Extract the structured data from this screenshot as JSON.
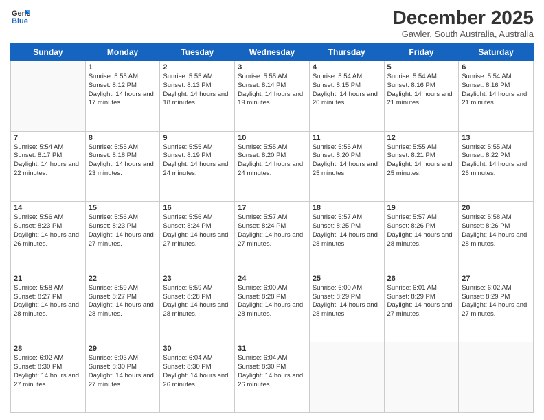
{
  "header": {
    "logo_line1": "General",
    "logo_line2": "Blue",
    "month": "December 2025",
    "location": "Gawler, South Australia, Australia"
  },
  "days_of_week": [
    "Sunday",
    "Monday",
    "Tuesday",
    "Wednesday",
    "Thursday",
    "Friday",
    "Saturday"
  ],
  "weeks": [
    [
      {
        "day": "",
        "sunrise": "",
        "sunset": "",
        "daylight": ""
      },
      {
        "day": "1",
        "sunrise": "Sunrise: 5:55 AM",
        "sunset": "Sunset: 8:12 PM",
        "daylight": "Daylight: 14 hours and 17 minutes."
      },
      {
        "day": "2",
        "sunrise": "Sunrise: 5:55 AM",
        "sunset": "Sunset: 8:13 PM",
        "daylight": "Daylight: 14 hours and 18 minutes."
      },
      {
        "day": "3",
        "sunrise": "Sunrise: 5:55 AM",
        "sunset": "Sunset: 8:14 PM",
        "daylight": "Daylight: 14 hours and 19 minutes."
      },
      {
        "day": "4",
        "sunrise": "Sunrise: 5:54 AM",
        "sunset": "Sunset: 8:15 PM",
        "daylight": "Daylight: 14 hours and 20 minutes."
      },
      {
        "day": "5",
        "sunrise": "Sunrise: 5:54 AM",
        "sunset": "Sunset: 8:16 PM",
        "daylight": "Daylight: 14 hours and 21 minutes."
      },
      {
        "day": "6",
        "sunrise": "Sunrise: 5:54 AM",
        "sunset": "Sunset: 8:16 PM",
        "daylight": "Daylight: 14 hours and 21 minutes."
      }
    ],
    [
      {
        "day": "7",
        "sunrise": "Sunrise: 5:54 AM",
        "sunset": "Sunset: 8:17 PM",
        "daylight": "Daylight: 14 hours and 22 minutes."
      },
      {
        "day": "8",
        "sunrise": "Sunrise: 5:55 AM",
        "sunset": "Sunset: 8:18 PM",
        "daylight": "Daylight: 14 hours and 23 minutes."
      },
      {
        "day": "9",
        "sunrise": "Sunrise: 5:55 AM",
        "sunset": "Sunset: 8:19 PM",
        "daylight": "Daylight: 14 hours and 24 minutes."
      },
      {
        "day": "10",
        "sunrise": "Sunrise: 5:55 AM",
        "sunset": "Sunset: 8:20 PM",
        "daylight": "Daylight: 14 hours and 24 minutes."
      },
      {
        "day": "11",
        "sunrise": "Sunrise: 5:55 AM",
        "sunset": "Sunset: 8:20 PM",
        "daylight": "Daylight: 14 hours and 25 minutes."
      },
      {
        "day": "12",
        "sunrise": "Sunrise: 5:55 AM",
        "sunset": "Sunset: 8:21 PM",
        "daylight": "Daylight: 14 hours and 25 minutes."
      },
      {
        "day": "13",
        "sunrise": "Sunrise: 5:55 AM",
        "sunset": "Sunset: 8:22 PM",
        "daylight": "Daylight: 14 hours and 26 minutes."
      }
    ],
    [
      {
        "day": "14",
        "sunrise": "Sunrise: 5:56 AM",
        "sunset": "Sunset: 8:23 PM",
        "daylight": "Daylight: 14 hours and 26 minutes."
      },
      {
        "day": "15",
        "sunrise": "Sunrise: 5:56 AM",
        "sunset": "Sunset: 8:23 PM",
        "daylight": "Daylight: 14 hours and 27 minutes."
      },
      {
        "day": "16",
        "sunrise": "Sunrise: 5:56 AM",
        "sunset": "Sunset: 8:24 PM",
        "daylight": "Daylight: 14 hours and 27 minutes."
      },
      {
        "day": "17",
        "sunrise": "Sunrise: 5:57 AM",
        "sunset": "Sunset: 8:24 PM",
        "daylight": "Daylight: 14 hours and 27 minutes."
      },
      {
        "day": "18",
        "sunrise": "Sunrise: 5:57 AM",
        "sunset": "Sunset: 8:25 PM",
        "daylight": "Daylight: 14 hours and 28 minutes."
      },
      {
        "day": "19",
        "sunrise": "Sunrise: 5:57 AM",
        "sunset": "Sunset: 8:26 PM",
        "daylight": "Daylight: 14 hours and 28 minutes."
      },
      {
        "day": "20",
        "sunrise": "Sunrise: 5:58 AM",
        "sunset": "Sunset: 8:26 PM",
        "daylight": "Daylight: 14 hours and 28 minutes."
      }
    ],
    [
      {
        "day": "21",
        "sunrise": "Sunrise: 5:58 AM",
        "sunset": "Sunset: 8:27 PM",
        "daylight": "Daylight: 14 hours and 28 minutes."
      },
      {
        "day": "22",
        "sunrise": "Sunrise: 5:59 AM",
        "sunset": "Sunset: 8:27 PM",
        "daylight": "Daylight: 14 hours and 28 minutes."
      },
      {
        "day": "23",
        "sunrise": "Sunrise: 5:59 AM",
        "sunset": "Sunset: 8:28 PM",
        "daylight": "Daylight: 14 hours and 28 minutes."
      },
      {
        "day": "24",
        "sunrise": "Sunrise: 6:00 AM",
        "sunset": "Sunset: 8:28 PM",
        "daylight": "Daylight: 14 hours and 28 minutes."
      },
      {
        "day": "25",
        "sunrise": "Sunrise: 6:00 AM",
        "sunset": "Sunset: 8:29 PM",
        "daylight": "Daylight: 14 hours and 28 minutes."
      },
      {
        "day": "26",
        "sunrise": "Sunrise: 6:01 AM",
        "sunset": "Sunset: 8:29 PM",
        "daylight": "Daylight: 14 hours and 27 minutes."
      },
      {
        "day": "27",
        "sunrise": "Sunrise: 6:02 AM",
        "sunset": "Sunset: 8:29 PM",
        "daylight": "Daylight: 14 hours and 27 minutes."
      }
    ],
    [
      {
        "day": "28",
        "sunrise": "Sunrise: 6:02 AM",
        "sunset": "Sunset: 8:30 PM",
        "daylight": "Daylight: 14 hours and 27 minutes."
      },
      {
        "day": "29",
        "sunrise": "Sunrise: 6:03 AM",
        "sunset": "Sunset: 8:30 PM",
        "daylight": "Daylight: 14 hours and 27 minutes."
      },
      {
        "day": "30",
        "sunrise": "Sunrise: 6:04 AM",
        "sunset": "Sunset: 8:30 PM",
        "daylight": "Daylight: 14 hours and 26 minutes."
      },
      {
        "day": "31",
        "sunrise": "Sunrise: 6:04 AM",
        "sunset": "Sunset: 8:30 PM",
        "daylight": "Daylight: 14 hours and 26 minutes."
      },
      {
        "day": "",
        "sunrise": "",
        "sunset": "",
        "daylight": ""
      },
      {
        "day": "",
        "sunrise": "",
        "sunset": "",
        "daylight": ""
      },
      {
        "day": "",
        "sunrise": "",
        "sunset": "",
        "daylight": ""
      }
    ]
  ]
}
